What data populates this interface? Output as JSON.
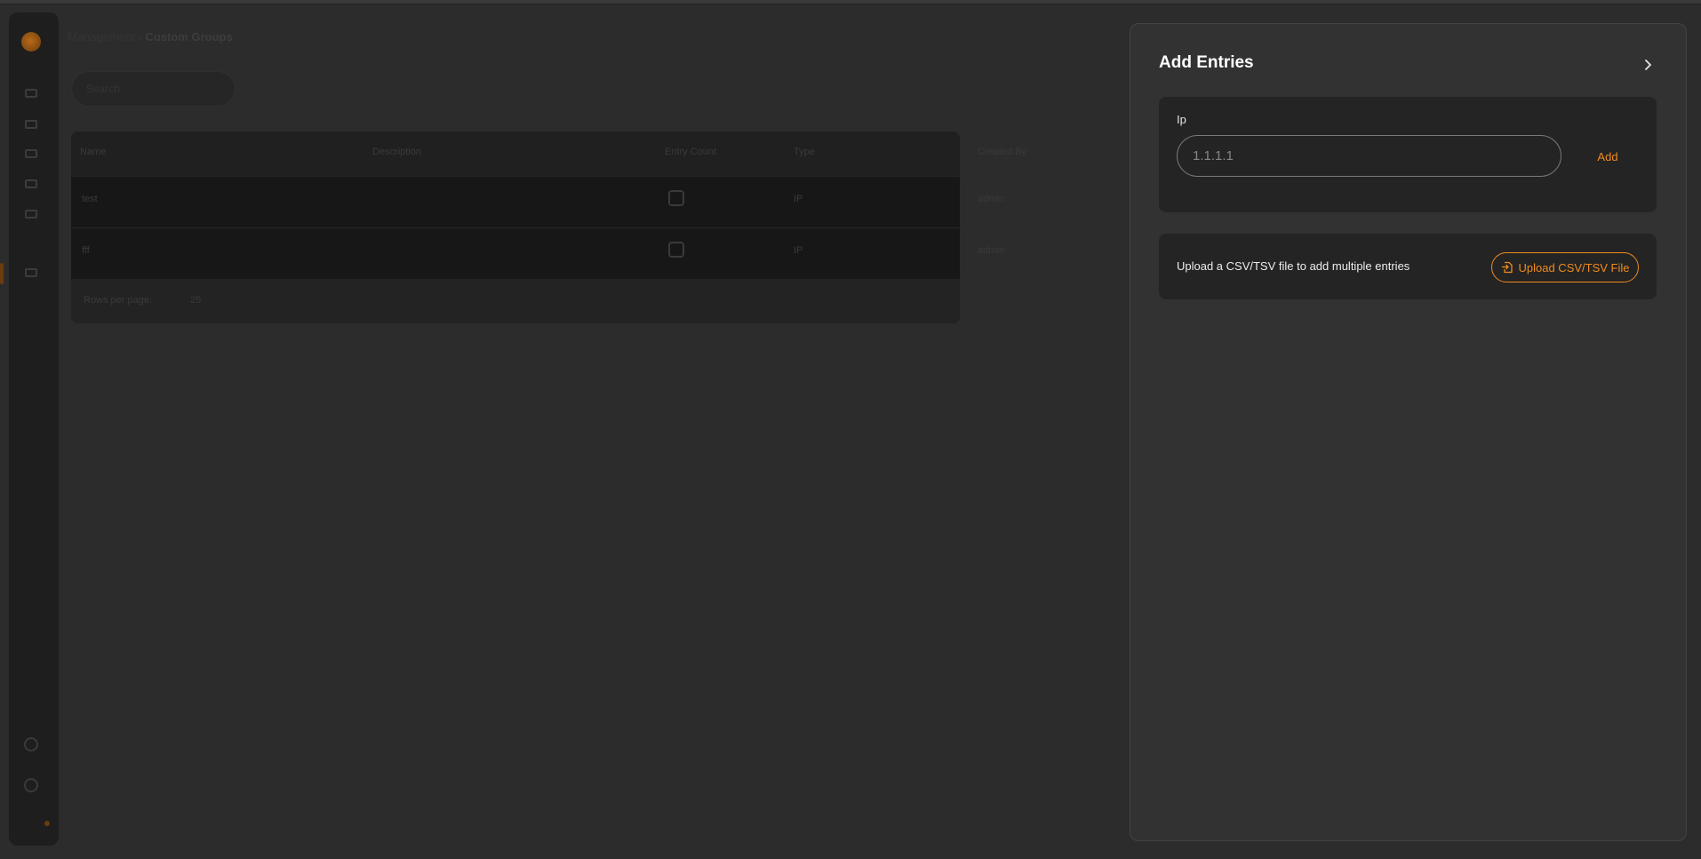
{
  "background": {
    "breadcrumb": {
      "parent": "Management",
      "current": "Custom Groups"
    },
    "search": {
      "placeholder": "Search"
    },
    "table": {
      "columns": [
        "Name",
        "Description",
        "Entry Count",
        "Type",
        "Created By"
      ],
      "rows": [
        {
          "name": "test",
          "type": "IP",
          "created_by": "admin"
        },
        {
          "name": "fff",
          "type": "IP",
          "created_by": "admin"
        }
      ],
      "rows_per_page_label": "Rows per page:",
      "rows_per_page_value": "25"
    }
  },
  "drawer": {
    "title": "Add Entries",
    "close_icon": "chevron-right-icon",
    "ip_card": {
      "label": "Ip",
      "placeholder": "1.1.1.1",
      "value": "",
      "add_label": "Add"
    },
    "upload_card": {
      "text": "Upload a CSV/TSV file to add multiple entries",
      "button_label": "Upload CSV/TSV File",
      "button_icon": "file-import-icon"
    }
  },
  "colors": {
    "accent": "#f08b1f",
    "drawer_bg": "#323232",
    "card_bg": "#242424",
    "page_bg": "#2c2c2c"
  }
}
